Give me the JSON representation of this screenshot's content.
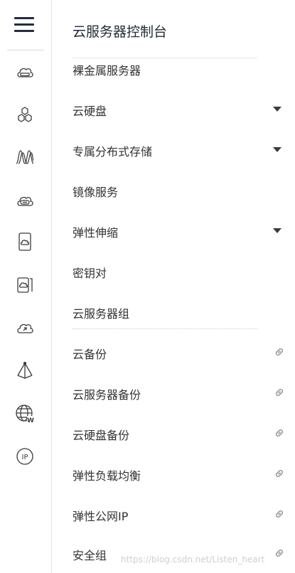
{
  "header": {
    "title": "云服务器控制台"
  },
  "menu": [
    {
      "label": "裸金属服务器"
    },
    {
      "label": "云硬盘",
      "indicator": "caret-down-icon"
    },
    {
      "label": "专属分布式存储",
      "indicator": "caret-down-icon"
    },
    {
      "label": "镜像服务"
    },
    {
      "label": "弹性伸缩",
      "indicator": "caret-down-icon"
    },
    {
      "label": "密钥对"
    },
    {
      "label": "云服务器组"
    },
    {
      "label": "云备份",
      "indicator": "link-icon"
    },
    {
      "label": "云服务器备份",
      "indicator": "link-icon"
    },
    {
      "label": "云硬盘备份",
      "indicator": "link-icon"
    },
    {
      "label": "弹性负载均衡",
      "indicator": "link-icon"
    },
    {
      "label": "弹性公网IP",
      "indicator": "link-icon"
    },
    {
      "label": "安全组",
      "indicator": "link-icon"
    }
  ],
  "rail_icons": [
    "cloud-server-icon",
    "hexagon-cluster-icon",
    "distributed-storage-icon",
    "cloud-disk-icon",
    "image-service-icon",
    "auto-scaling-icon",
    "cloud-backup-icon",
    "load-balancer-icon",
    "elastic-ip-globe-icon",
    "ip-icon"
  ],
  "ip_icon_text": "IP",
  "globe_badge": "W",
  "watermark": "https://blog.csdn.net/Listen_heart",
  "colors": {
    "text": "#333333",
    "title": "#252b3a",
    "divider": "#e3e3e3",
    "icon": "#3b3b3b"
  }
}
